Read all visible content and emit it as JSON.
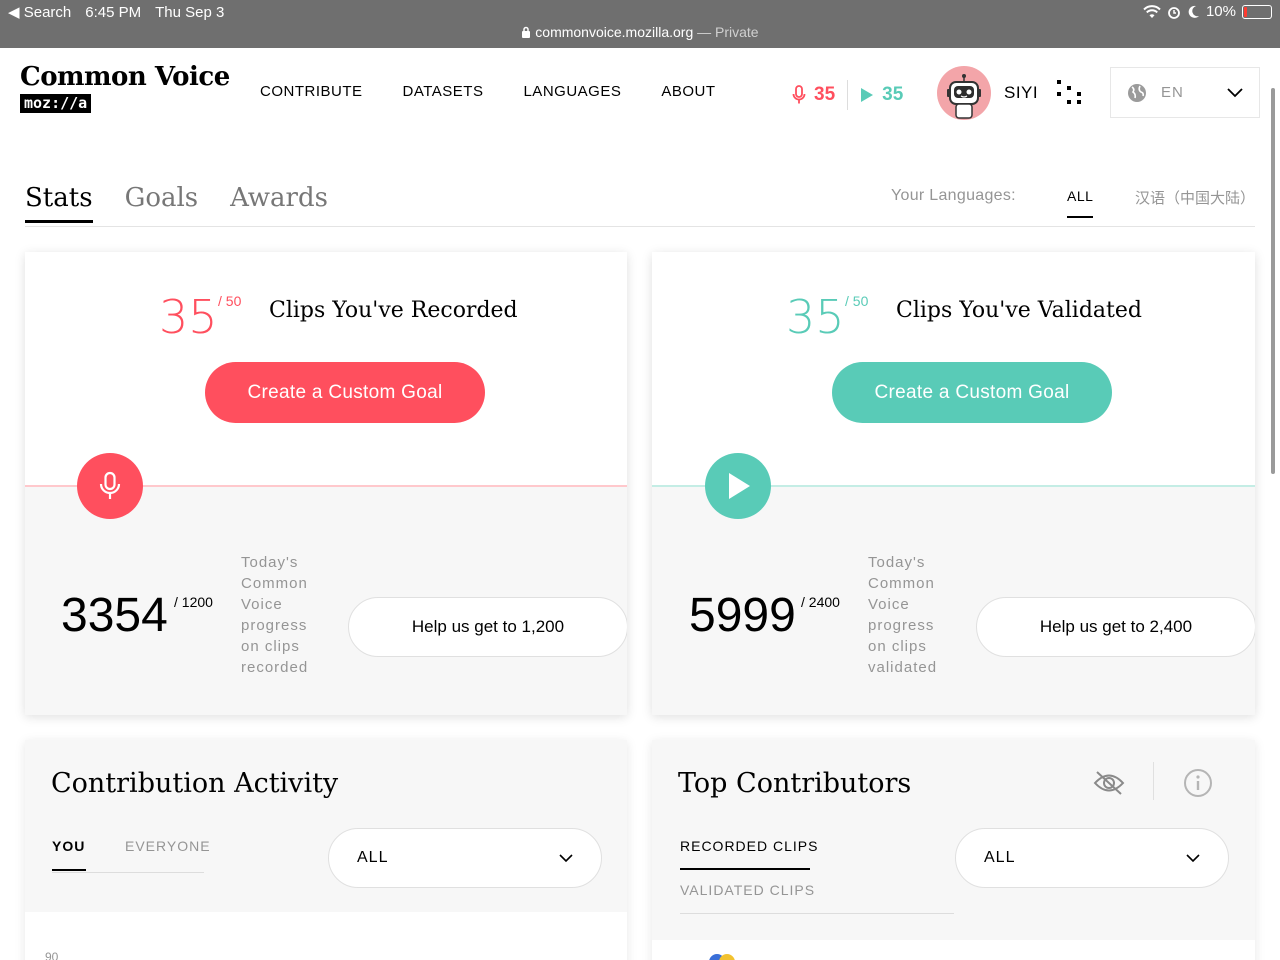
{
  "status_bar": {
    "back_label": "Search",
    "time": "6:45 PM",
    "date": "Thu Sep 3",
    "battery": "10%",
    "battery_level": 0.1
  },
  "url_bar": {
    "domain": "commonvoice.mozilla.org",
    "mode": " — Private"
  },
  "header": {
    "logo_title": "Common Voice",
    "logo_sub": "moz://a",
    "nav": [
      "CONTRIBUTE",
      "DATASETS",
      "LANGUAGES",
      "ABOUT"
    ],
    "recorded_count": "35",
    "validated_count": "35",
    "username": "SIYI",
    "language": "EN"
  },
  "tabs": {
    "items": [
      "Stats",
      "Goals",
      "Awards"
    ],
    "active": "Stats",
    "your_languages_label": "Your Languages:",
    "language_filters": [
      "ALL",
      "汉语（中国大陆）"
    ]
  },
  "record_card": {
    "goal_value": "35",
    "goal_total": "/ 50",
    "goal_label": "Clips You've Recorded",
    "goal_button": "Create a Custom Goal",
    "today_value": "3354",
    "today_total": "/ 1200",
    "today_text": "Today's Common Voice progress on clips recorded",
    "help_button": "Help us get to 1,200"
  },
  "validate_card": {
    "goal_value": "35",
    "goal_total": "/ 50",
    "goal_label": "Clips You've Validated",
    "goal_button": "Create a Custom Goal",
    "today_value": "5999",
    "today_total": "/ 2400",
    "today_text": "Today's Common Voice progress on clips validated",
    "help_button": "Help us get to 2,400"
  },
  "activity_card": {
    "title": "Contribution Activity",
    "tabs": [
      "YOU",
      "EVERYONE"
    ],
    "select_value": "ALL",
    "axis_first_tick": "90"
  },
  "contributors_card": {
    "title": "Top Contributors",
    "tabs": [
      "RECORDED CLIPS",
      "VALIDATED CLIPS"
    ],
    "select_value": "ALL"
  },
  "colors": {
    "record": "#ff4f5e",
    "validate": "#59cbb7",
    "chrome": "#6f6f6f"
  },
  "icons": [
    "back-arrow-icon",
    "wifi-icon",
    "alarm-icon",
    "moon-icon",
    "battery-icon",
    "lock-icon",
    "mic-icon",
    "play-icon",
    "avatar-robot-icon",
    "dots-menu-icon",
    "globe-icon",
    "chevron-down-icon",
    "eye-slash-icon",
    "info-icon"
  ]
}
